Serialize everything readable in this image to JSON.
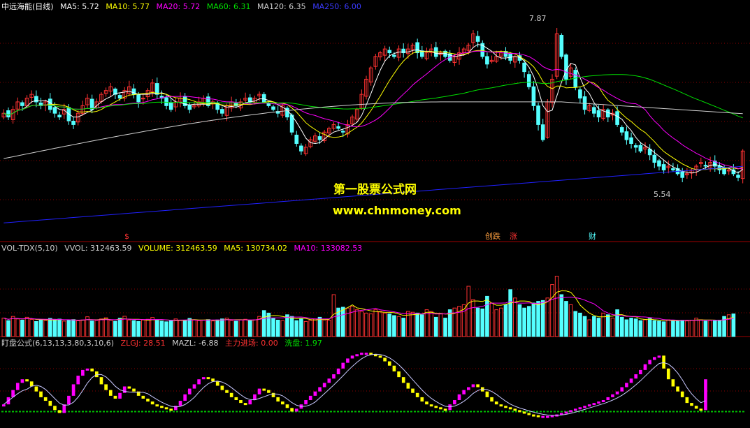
{
  "main_header": {
    "stock": "中远海能(日线)",
    "ma5": "MA5: 5.72",
    "ma10": "MA10: 5.77",
    "ma20": "MA20: 5.72",
    "ma60": "MA60: 6.31",
    "ma120": "MA120: 6.35",
    "ma250": "MA250: 6.00"
  },
  "vol_header": {
    "name": "VOL-TDX(5,10)",
    "vvol": "VVOL: 312463.59",
    "volume": "VOLUME: 312463.59",
    "ma5": "MA5: 130734.02",
    "ma10": "MA10: 133082.53"
  },
  "ind_header": {
    "name": "盯盘公式(6,13,13,3,80,3,10,6)",
    "zlgj": "ZLGJ: 28.51",
    "mazl": "MAZL: -6.88",
    "zljc": "主力进场: 0.00",
    "xp": "洗盘: 1.97"
  },
  "annotations": {
    "high": "7.87",
    "low": "5.54"
  },
  "markers": {
    "s": "$",
    "e1": "创跌",
    "e2": "涨",
    "cai": "财"
  },
  "watermark": {
    "line1": "第一股票公式网",
    "line2": "www.chnmoney.com"
  },
  "colors": {
    "up": "#ff3232",
    "down": "#54ffff",
    "ma5": "#ffffff",
    "ma10": "#ffff00",
    "ma20": "#ff00ff",
    "ma60": "#00e000",
    "ma120": "#d0d0d0",
    "ma250": "#2020ff",
    "mag": "#ff00ff",
    "yel": "#ffff00",
    "grid": "#8b0000"
  },
  "chart_data": [
    {
      "type": "candlestick",
      "panel": "price",
      "ylim": [
        5.2,
        8.1
      ],
      "closes": [
        6.75,
        6.7,
        6.8,
        6.9,
        6.85,
        6.95,
        7.0,
        6.9,
        6.85,
        6.9,
        6.8,
        6.75,
        6.7,
        6.8,
        6.65,
        6.6,
        6.75,
        6.85,
        6.95,
        6.8,
        6.9,
        7.0,
        7.05,
        7.1,
        7.0,
        6.95,
        7.05,
        7.1,
        7.0,
        6.9,
        6.95,
        7.05,
        7.15,
        7.0,
        6.95,
        6.85,
        6.8,
        6.9,
        6.95,
        6.85,
        6.8,
        6.85,
        6.9,
        6.95,
        6.85,
        6.9,
        6.8,
        6.75,
        6.85,
        6.9,
        6.85,
        6.9,
        6.95,
        6.9,
        6.95,
        7.0,
        6.9,
        6.85,
        6.8,
        6.75,
        6.85,
        6.7,
        6.5,
        6.35,
        6.25,
        6.3,
        6.4,
        6.45,
        6.4,
        6.5,
        6.55,
        6.6,
        6.55,
        6.5,
        6.6,
        6.7,
        6.8,
        7.0,
        7.2,
        7.35,
        7.5,
        7.55,
        7.6,
        7.55,
        7.5,
        7.6,
        7.55,
        7.6,
        7.65,
        7.55,
        7.5,
        7.55,
        7.6,
        7.5,
        7.55,
        7.5,
        7.45,
        7.5,
        7.55,
        7.6,
        7.65,
        7.8,
        7.7,
        7.5,
        7.4,
        7.45,
        7.5,
        7.55,
        7.5,
        7.45,
        7.5,
        7.45,
        7.3,
        7.1,
        6.85,
        6.6,
        6.4,
        6.9,
        7.2,
        7.8,
        7.5,
        7.2,
        7.35,
        7.1,
        6.95,
        6.8,
        6.85,
        6.75,
        6.7,
        6.8,
        6.7,
        6.75,
        6.6,
        6.5,
        6.4,
        6.35,
        6.3,
        6.25,
        6.3,
        6.2,
        6.1,
        6.05,
        6.0,
        6.05,
        6.0,
        5.95,
        5.9,
        5.95,
        6.0,
        6.05,
        6.1,
        6.05,
        6.1,
        6.05,
        6.0,
        5.95,
        6.0,
        5.95,
        5.9,
        6.25
      ]
    },
    {
      "type": "bar",
      "panel": "volume",
      "ylim": [
        0,
        500000
      ],
      "values": [
        110000,
        95000,
        120000,
        105000,
        98000,
        115000,
        102000,
        90000,
        100000,
        96000,
        108000,
        99000,
        104000,
        92000,
        97000,
        101000,
        94000,
        99000,
        118000,
        93000,
        96000,
        105000,
        112000,
        97000,
        91000,
        109000,
        121000,
        99000,
        95000,
        90000,
        99000,
        103000,
        114000,
        96000,
        92000,
        88000,
        97000,
        105000,
        98000,
        94000,
        108000,
        99000,
        95000,
        97000,
        101000,
        93000,
        99000,
        105000,
        110000,
        96000,
        92000,
        99000,
        103000,
        98000,
        100000,
        120000,
        155000,
        140000,
        110000,
        98000,
        95000,
        130000,
        120000,
        95000,
        105000,
        90000,
        96000,
        105000,
        115000,
        99000,
        98000,
        250000,
        170000,
        175000,
        170000,
        180000,
        160000,
        150000,
        140000,
        135000,
        160000,
        150000,
        140000,
        135000,
        125000,
        120000,
        110000,
        150000,
        145000,
        140000,
        130000,
        160000,
        150000,
        115000,
        135000,
        110000,
        160000,
        170000,
        180000,
        190000,
        300000,
        220000,
        170000,
        165000,
        240000,
        200000,
        160000,
        170000,
        190000,
        280000,
        230000,
        190000,
        170000,
        180000,
        200000,
        210000,
        215000,
        230000,
        310000,
        360000,
        250000,
        210000,
        190000,
        150000,
        140000,
        120000,
        100000,
        120000,
        110000,
        140000,
        130000,
        110000,
        160000,
        115000,
        100000,
        110000,
        105000,
        95000,
        100000,
        108000,
        95000,
        92000,
        88000,
        100000,
        98000,
        96000,
        97000,
        93000,
        98000,
        110000,
        100000,
        92000,
        96000,
        94000,
        98000,
        120000,
        130000,
        135000
      ]
    },
    {
      "type": "bar",
      "panel": "indicator",
      "ylim": [
        -10,
        100
      ],
      "values": [
        20,
        30,
        40,
        50,
        55,
        52,
        45,
        38,
        30,
        25,
        18,
        12,
        8,
        20,
        32,
        48,
        60,
        68,
        70,
        66,
        58,
        48,
        40,
        32,
        28,
        36,
        45,
        42,
        38,
        32,
        28,
        24,
        20,
        18,
        16,
        14,
        12,
        18,
        25,
        34,
        42,
        48,
        55,
        58,
        56,
        52,
        46,
        40,
        36,
        30,
        26,
        22,
        20,
        26,
        34,
        42,
        40,
        36,
        30,
        24,
        20,
        15,
        10,
        14,
        20,
        26,
        32,
        38,
        44,
        50,
        56,
        62,
        70,
        78,
        84,
        88,
        90,
        92,
        92,
        90,
        88,
        85,
        80,
        74,
        66,
        58,
        50,
        42,
        36,
        30,
        24,
        20,
        18,
        16,
        14,
        12,
        20,
        26,
        34,
        40,
        44,
        48,
        44,
        38,
        30,
        24,
        20,
        18,
        16,
        14,
        12,
        10,
        8,
        6,
        5,
        4,
        4,
        4,
        5,
        6,
        8,
        10,
        12,
        14,
        16,
        18,
        20,
        22,
        24,
        26,
        30,
        34,
        38,
        44,
        50,
        56,
        62,
        68,
        76,
        82,
        86,
        88,
        70,
        55,
        45,
        38,
        30,
        22,
        18,
        14,
        12,
        55
      ]
    }
  ]
}
